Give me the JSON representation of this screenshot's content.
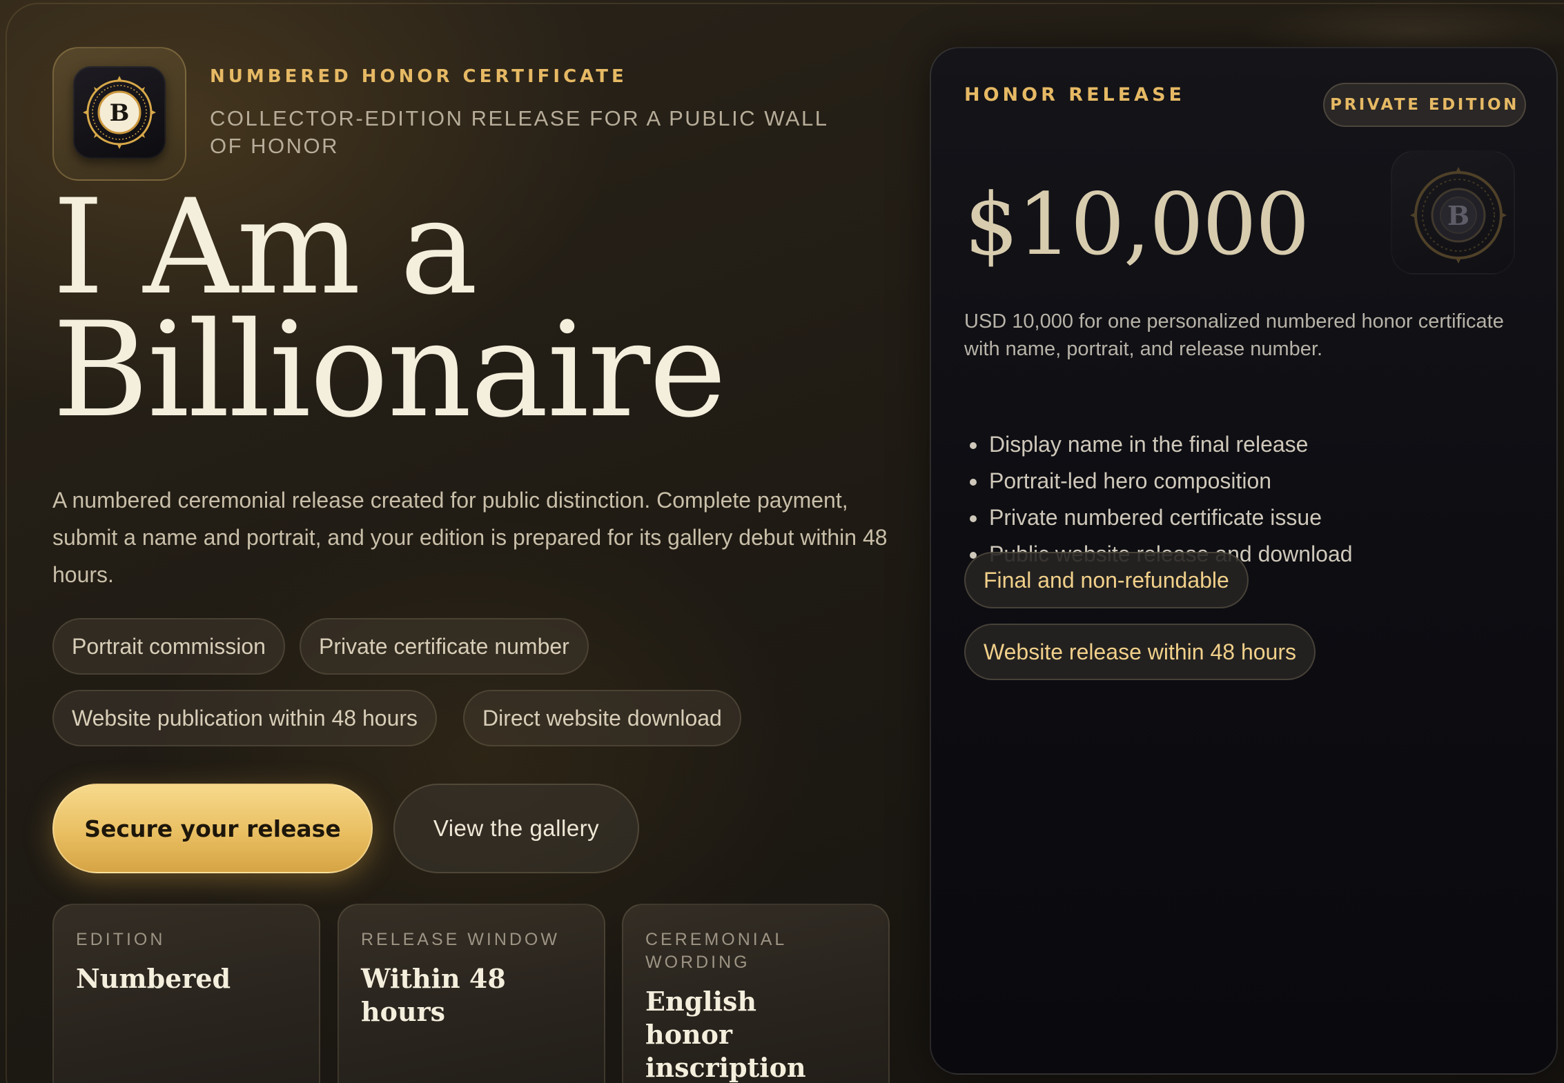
{
  "header": {
    "eyebrow": "NUMBERED HONOR CERTIFICATE",
    "subtitle": "COLLECTOR-EDITION RELEASE FOR A PUBLIC WALL OF HONOR",
    "logo_letter": "B"
  },
  "hero": {
    "title_line1": "I Am a",
    "title_line2": "Billionaire",
    "lede": "A numbered ceremonial release created for public distinction. Complete payment, submit a name and portrait, and your edition is prepared for its gallery debut within 48 hours."
  },
  "chips": [
    "Portrait commission",
    "Private certificate number",
    "Website publication within 48 hours",
    "Direct website download"
  ],
  "actions": {
    "primary": "Secure your release",
    "secondary": "View the gallery"
  },
  "stats": [
    {
      "label": "EDITION",
      "value": "Numbered"
    },
    {
      "label": "RELEASE WINDOW",
      "value": "Within 48 hours"
    },
    {
      "label": "CEREMONIAL WORDING",
      "value": "English honor inscription"
    }
  ],
  "panel": {
    "eyebrow": "HONOR RELEASE",
    "badge": "PRIVATE EDITION",
    "price": "$10,000",
    "description": "USD 10,000 for one personalized numbered honor certificate with name, portrait, and release number.",
    "features": [
      "Display name in the final release",
      "Portrait-led hero composition",
      "Private numbered certificate issue",
      "Public website release and download"
    ],
    "notices": [
      "Final and non-refundable",
      "Website release within 48 hours"
    ]
  },
  "colors": {
    "accent_gold": "#e6b964",
    "button_gold": "#e9bf62",
    "background": "#221d15",
    "panel_background": "#0d0d12"
  },
  "icons": {
    "logo": "crest-seal-icon",
    "panel_seal": "crest-seal-icon"
  }
}
